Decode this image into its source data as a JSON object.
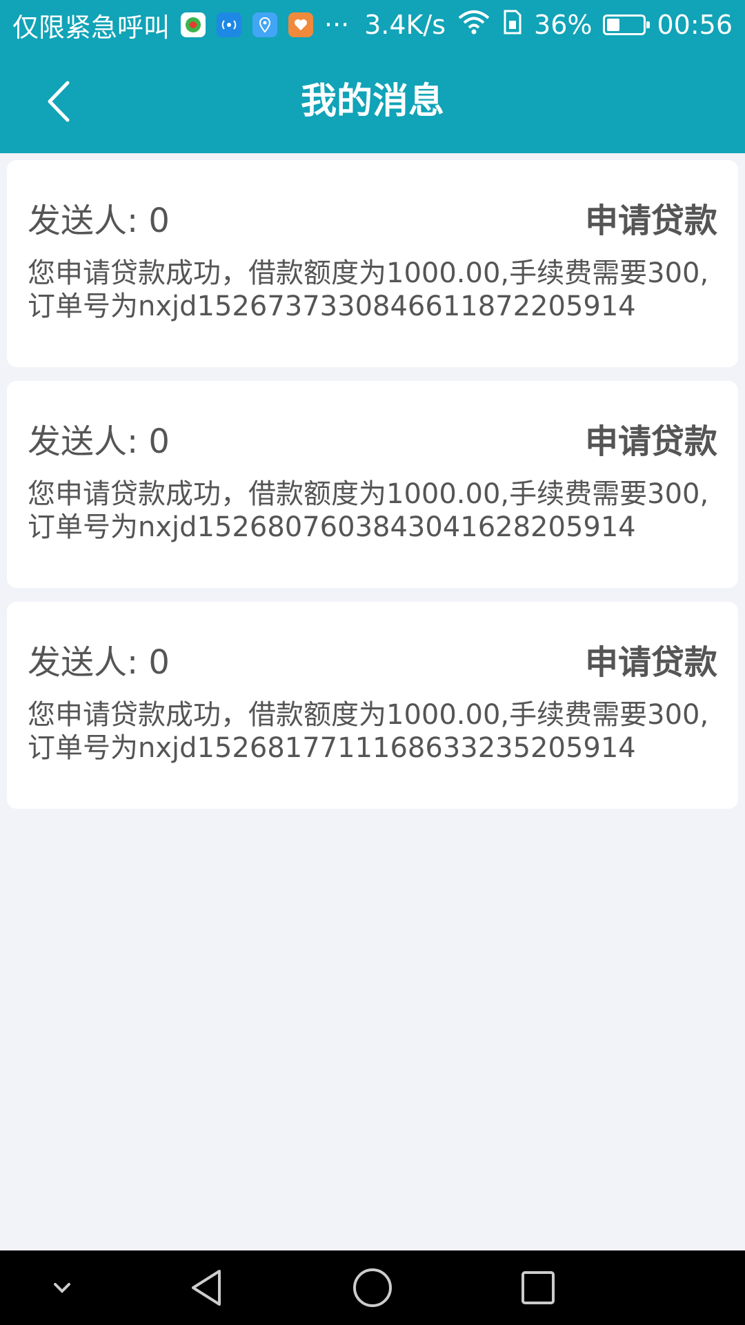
{
  "status_bar": {
    "carrier_text": "仅限紧急呼叫",
    "more_indicator": "···",
    "network_speed": "3.4K/s",
    "battery_percent": "36%",
    "battery_level": 0.36,
    "time": "00:56",
    "icons": [
      "app-icon-green",
      "signal-broadcast-icon",
      "location-pin-icon",
      "health-app-icon",
      "wifi-icon",
      "sim-card-icon",
      "battery-icon"
    ]
  },
  "header": {
    "title": "我的消息",
    "back_icon": "chevron-left-icon"
  },
  "messages": [
    {
      "sender": "发送人: 0",
      "type": "申请贷款",
      "content": "您申请贷款成功，借款额度为1000.00,手续费需要300,订单号为nxjd1526737330846611872205914"
    },
    {
      "sender": "发送人: 0",
      "type": "申请贷款",
      "content": "您申请贷款成功，借款额度为1000.00,手续费需要300,订单号为nxjd1526807603843041628205914"
    },
    {
      "sender": "发送人: 0",
      "type": "申请贷款",
      "content": "您申请贷款成功，借款额度为1000.00,手续费需要300,订单号为nxjd1526817711168633235205914"
    }
  ],
  "nav_bar": {
    "icons": [
      "chevron-down-icon",
      "back-triangle-icon",
      "home-circle-icon",
      "recents-square-icon"
    ]
  },
  "colors": {
    "accent": "#11a3b7",
    "background": "#f2f3f8",
    "card": "#ffffff",
    "text": "#555555"
  }
}
